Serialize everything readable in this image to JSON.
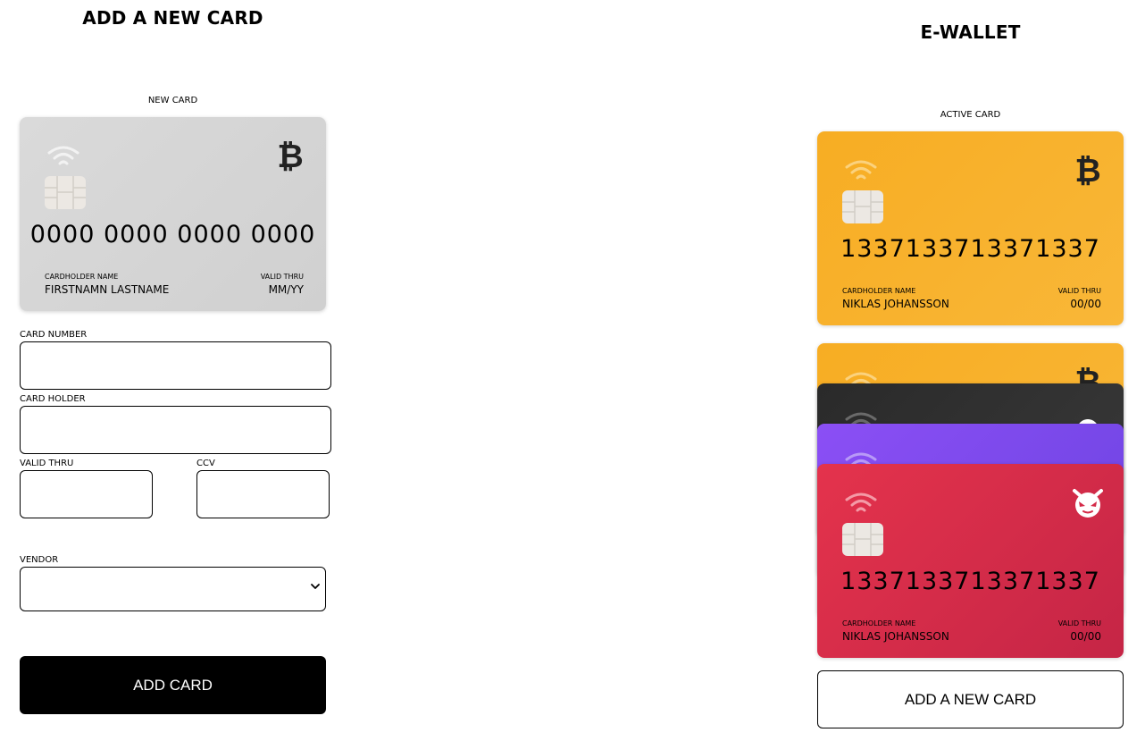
{
  "add_card": {
    "title": "ADD A NEW CARD",
    "preview_caption": "NEW CARD",
    "preview": {
      "number": "0000 0000 0000 0000",
      "holder_label": "CARDHOLDER NAME",
      "holder": "FIRSTNAMN LASTNAME",
      "valid_label": "VALID THRU",
      "valid": "MM/YY",
      "vendor_icon": "bitcoin-icon"
    },
    "form": {
      "card_number_label": "CARD NUMBER",
      "card_number_value": "",
      "card_holder_label": "CARD HOLDER",
      "card_holder_value": "",
      "valid_thru_label": "VALID THRU",
      "valid_thru_value": "",
      "ccv_label": "CCV",
      "ccv_value": "",
      "vendor_label": "VENDOR",
      "vendor_value": ""
    },
    "submit_label": "ADD CARD"
  },
  "wallet": {
    "title": "E-WALLET",
    "active_caption": "ACTIVE CARD",
    "active_card": {
      "number": "1337133713371337",
      "holder_label": "CARDHOLDER NAME",
      "holder": "NIKLAS JOHANSSON",
      "valid_label": "VALID THRU",
      "valid": "00/00",
      "vendor_icon": "bitcoin-icon",
      "color": "#f7ad23"
    },
    "stack": [
      {
        "vendor_icon": "bitcoin-icon",
        "color": "#f7ad23"
      },
      {
        "vendor_icon": "ninja-icon",
        "color": "#2a2a2a"
      },
      {
        "vendor_icon": "chain-icon",
        "color": "#8b4ff5"
      },
      {
        "vendor_icon": "evil-icon",
        "color": "#e4334c",
        "number": "1337133713371337",
        "holder_label": "CARDHOLDER NAME",
        "holder": "NIKLAS JOHANSSON",
        "valid_label": "VALID THRU",
        "valid": "00/00"
      }
    ],
    "add_new_label": "ADD A NEW CARD"
  }
}
